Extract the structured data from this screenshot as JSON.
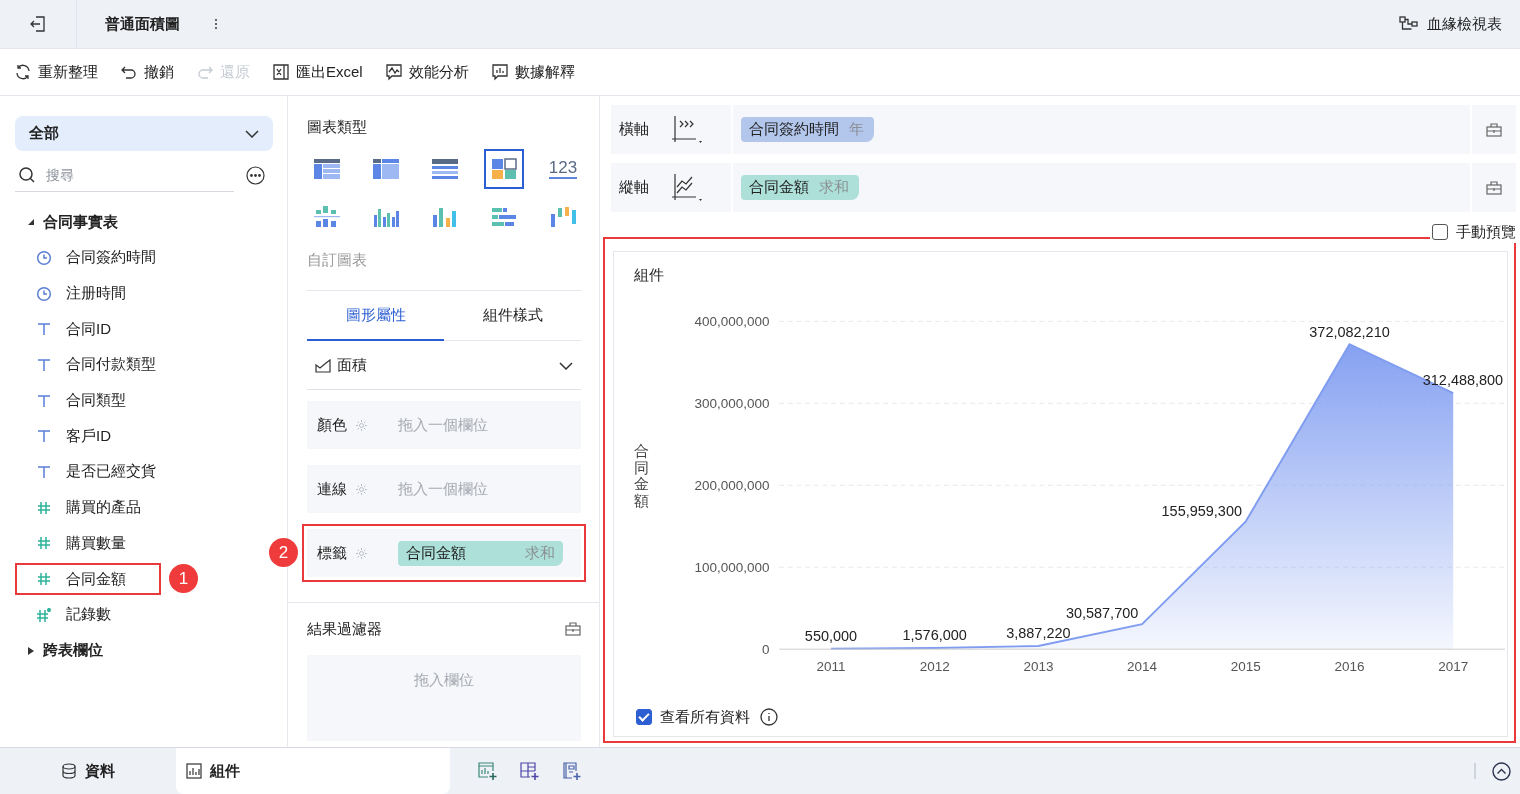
{
  "header": {
    "title": "普通面積圖",
    "lineage_link": "血緣檢視表"
  },
  "toolbar": [
    {
      "kind": "refresh",
      "label": "重新整理",
      "disabled": false
    },
    {
      "kind": "undo",
      "label": "撤銷",
      "disabled": false
    },
    {
      "kind": "redo",
      "label": "還原",
      "disabled": true
    },
    {
      "kind": "excel",
      "label": "匯出Excel",
      "disabled": false
    },
    {
      "kind": "performance",
      "label": "效能分析",
      "disabled": false
    },
    {
      "kind": "explain",
      "label": "數據解釋",
      "disabled": false
    }
  ],
  "sidebar": {
    "dataset": "全部",
    "search": {
      "placeholder": "搜尋"
    },
    "tree": [
      {
        "label": "合同事實表",
        "expanded": true,
        "children": [
          {
            "kind": "time",
            "label": "合同簽約時間",
            "highlighted": false
          },
          {
            "kind": "time",
            "label": "注册時間",
            "highlighted": false
          },
          {
            "kind": "text",
            "label": "合同ID",
            "highlighted": false
          },
          {
            "kind": "text",
            "label": "合同付款類型",
            "highlighted": false
          },
          {
            "kind": "text",
            "label": "合同類型",
            "highlighted": false
          },
          {
            "kind": "text",
            "label": "客戶ID",
            "highlighted": false
          },
          {
            "kind": "text",
            "label": "是否已經交貨",
            "highlighted": false
          },
          {
            "kind": "number",
            "label": "購買的產品",
            "highlighted": false
          },
          {
            "kind": "number",
            "label": "購買數量",
            "highlighted": false
          },
          {
            "kind": "number",
            "label": "合同金額",
            "highlighted": true,
            "badge": "1"
          },
          {
            "kind": "count",
            "label": "記錄數",
            "highlighted": false
          }
        ]
      },
      {
        "label": "跨表欄位",
        "expanded": false
      }
    ]
  },
  "chart_types": {
    "title": "圖表類型",
    "custom_label": "自訂圖表",
    "items": [
      {
        "kind": "detail-table",
        "selected": false
      },
      {
        "kind": "group-table",
        "selected": false
      },
      {
        "kind": "cross-table",
        "selected": false
      },
      {
        "kind": "dashboard",
        "selected": true
      },
      {
        "kind": "number-card",
        "text": "123",
        "selected": false
      },
      {
        "kind": "scatter-bar",
        "selected": false
      },
      {
        "kind": "grouped-bar",
        "selected": false
      },
      {
        "kind": "color-bar",
        "selected": false
      },
      {
        "kind": "stacked-bar",
        "selected": false
      },
      {
        "kind": "range-bar",
        "selected": false
      }
    ]
  },
  "property_tabs": [
    {
      "label": "圖形屬性",
      "selected": true
    },
    {
      "label": "組件樣式",
      "selected": false
    }
  ],
  "mark_type": "面積",
  "slots": [
    {
      "label": "顏色",
      "placeholder": "拖入一個欄位",
      "highlighted": false
    },
    {
      "label": "連線",
      "placeholder": "拖入一個欄位",
      "highlighted": false
    },
    {
      "label": "標籤",
      "chip": {
        "field": "合同金額",
        "aggregation": "求和"
      },
      "highlighted": true,
      "badge": "2"
    }
  ],
  "result_filter": {
    "title": "結果過濾器",
    "placeholder": "拖入欄位"
  },
  "axes": [
    {
      "label": "橫軸",
      "kind": "x",
      "chip": {
        "field": "合同簽約時間",
        "aggregation": "年",
        "color": "#b3c6ec"
      }
    },
    {
      "label": "縱軸",
      "kind": "y",
      "chip": {
        "field": "合同金額",
        "aggregation": "求和",
        "color": "#ace0d8"
      }
    }
  ],
  "manual_preview": {
    "label": "手動預覽",
    "checked": false
  },
  "widget": {
    "title": "組件",
    "highlighted": true,
    "show_all": {
      "label": "查看所有資料",
      "checked": true
    },
    "chart_data": {
      "type": "area",
      "ylabel": "合同金額",
      "categories": [
        "2011",
        "2012",
        "2013",
        "2014",
        "2015",
        "2016",
        "2017"
      ],
      "series": [
        {
          "color": "#7f9cf0",
          "values": [
            550000,
            1576000,
            3887220,
            30587700,
            155959300,
            372082210,
            312488800
          ]
        }
      ],
      "value_labels": [
        "550,000",
        "1,576,000",
        "3,887,220",
        "30,587,700",
        "155,959,300",
        "372,082,210",
        "312,488,800"
      ],
      "grid": true,
      "ylim": [
        0,
        400000000
      ],
      "yticks": [
        {
          "value": 0,
          "label": "0"
        },
        {
          "value": 100000000,
          "label": "100,000,000"
        },
        {
          "value": 200000000,
          "label": "200,000,000"
        },
        {
          "value": 300000000,
          "label": "300,000,000"
        },
        {
          "value": 400000000,
          "label": "400,000,000"
        }
      ],
      "data_labels": "value_labels"
    }
  },
  "bottom_tabs": [
    {
      "kind": "data",
      "label": "資料",
      "selected": false
    },
    {
      "kind": "widget",
      "label": "組件",
      "selected": true
    }
  ]
}
